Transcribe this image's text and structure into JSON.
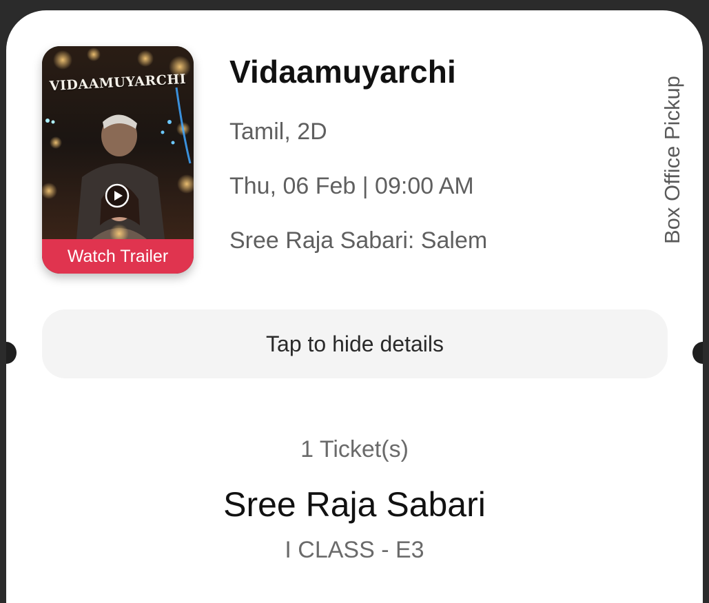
{
  "poster": {
    "title_art": "VIDAAMUYARCHI",
    "trailer_label": "Watch Trailer"
  },
  "movie": {
    "title": "Vidaamuyarchi",
    "language_format": "Tamil, 2D",
    "datetime": "Thu, 06 Feb | 09:00 AM",
    "venue": "Sree Raja Sabari: Salem"
  },
  "pickup_label": "Box Office Pickup",
  "toggle_label": "Tap to hide details",
  "booking": {
    "ticket_count": "1 Ticket(s)",
    "theatre": "Sree Raja Sabari",
    "seat": "I CLASS - E3"
  },
  "colors": {
    "accent": "#e0344f",
    "background": "#ffffff",
    "toggle_bg": "#f4f4f4"
  }
}
